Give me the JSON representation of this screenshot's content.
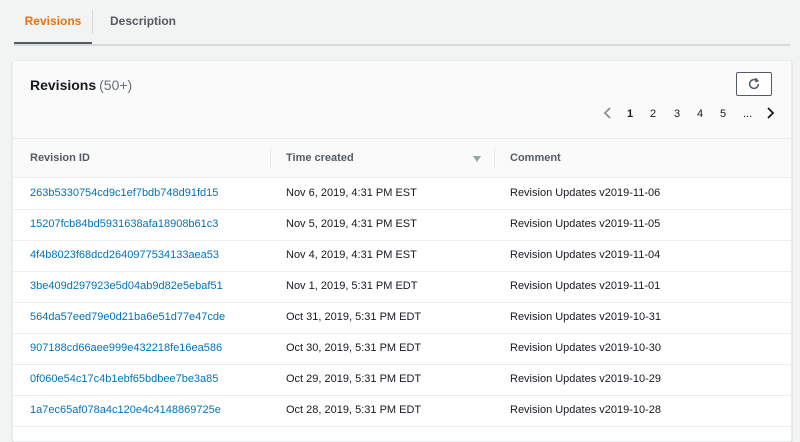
{
  "tabs": [
    {
      "label": "Revisions",
      "active": true
    },
    {
      "label": "Description",
      "active": false
    }
  ],
  "panel": {
    "title": "Revisions",
    "count": "(50+)",
    "refresh_icon": "refresh-icon"
  },
  "pagination": {
    "prev_icon": "chevron-left-icon",
    "next_icon": "chevron-right-icon",
    "pages": [
      "1",
      "2",
      "3",
      "4",
      "5",
      "..."
    ],
    "current": "1"
  },
  "table": {
    "columns": [
      "Revision ID",
      "Time created",
      "Comment"
    ],
    "sort_icon": "sort-descending-icon",
    "rows": [
      {
        "id": "263b5330754cd9c1ef7bdb748d91fd15",
        "time": "Nov 6, 2019, 4:31 PM EST",
        "comment": "Revision Updates v2019-11-06"
      },
      {
        "id": "15207fcb84bd5931638afa18908b61c3",
        "time": "Nov 5, 2019, 4:31 PM EST",
        "comment": "Revision Updates v2019-11-05"
      },
      {
        "id": "4f4b8023f68dcd2640977534133aea53",
        "time": "Nov 4, 2019, 4:31 PM EST",
        "comment": "Revision Updates v2019-11-04"
      },
      {
        "id": "3be409d297923e5d04ab9d82e5ebaf51",
        "time": "Nov 1, 2019, 5:31 PM EDT",
        "comment": "Revision Updates v2019-11-01"
      },
      {
        "id": "564da57eed79e0d21ba6e51d77e47cde",
        "time": "Oct 31, 2019, 5:31 PM EDT",
        "comment": "Revision Updates v2019-10-31"
      },
      {
        "id": "907188cd66aee999e432218fe16ea586",
        "time": "Oct 30, 2019, 5:31 PM EDT",
        "comment": "Revision Updates v2019-10-30"
      },
      {
        "id": "0f060e54c17c4b1ebf65bdbee7be3a85",
        "time": "Oct 29, 2019, 5:31 PM EDT",
        "comment": "Revision Updates v2019-10-29"
      },
      {
        "id": "1a7ec65af078a4c120e4c4148869725e",
        "time": "Oct 28, 2019, 5:31 PM EDT",
        "comment": "Revision Updates v2019-10-28"
      }
    ]
  },
  "colors": {
    "active_tab": "#ec7211",
    "link": "#0073bb",
    "border": "#eaeded"
  }
}
